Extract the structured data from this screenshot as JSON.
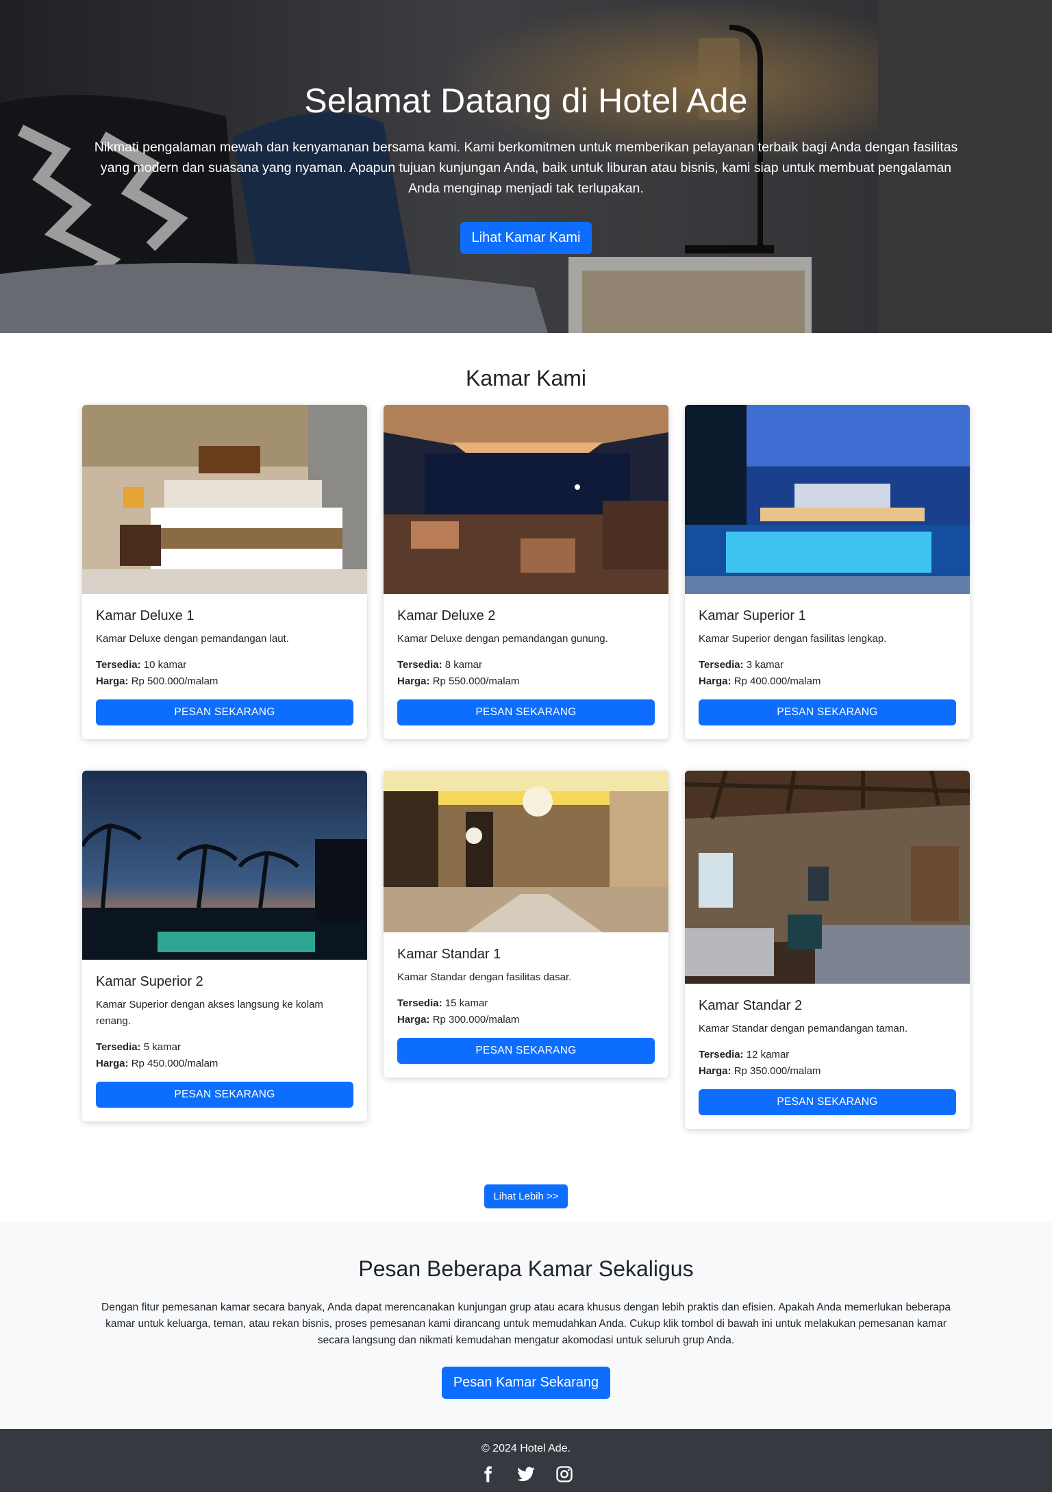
{
  "hero": {
    "title": "Selamat Datang di Hotel Ade",
    "text": "Nikmati pengalaman mewah dan kenyamanan bersama kami. Kami berkomitmen untuk memberikan pelayanan terbaik bagi Anda dengan fasilitas yang modern dan suasana yang nyaman. Apapun tujuan kunjungan Anda, baik untuk liburan atau bisnis, kami siap untuk membuat pengalaman Anda menginap menjadi tak terlupakan.",
    "button": "Lihat Kamar Kami"
  },
  "rooms": {
    "title": "Kamar Kami",
    "available_label": "Tersedia:",
    "price_label": "Harga:",
    "items": [
      {
        "name": "Kamar Deluxe 1",
        "desc": "Kamar Deluxe dengan pemandangan laut.",
        "available": "10 kamar",
        "price": "Rp 500.000/malam",
        "button": "Pesan Sekarang"
      },
      {
        "name": "Kamar Deluxe 2",
        "desc": "Kamar Deluxe dengan pemandangan gunung.",
        "available": "8 kamar",
        "price": "Rp 550.000/malam",
        "button": "Pesan Sekarang"
      },
      {
        "name": "Kamar Superior 1",
        "desc": "Kamar Superior dengan fasilitas lengkap.",
        "available": "3 kamar",
        "price": "Rp 400.000/malam",
        "button": "Pesan Sekarang"
      },
      {
        "name": "Kamar Superior 2",
        "desc": "Kamar Superior dengan akses langsung ke kolam renang.",
        "available": "5 kamar",
        "price": "Rp 450.000/malam",
        "button": "Pesan Sekarang"
      },
      {
        "name": "Kamar Standar 1",
        "desc": "Kamar Standar dengan fasilitas dasar.",
        "available": "15 kamar",
        "price": "Rp 300.000/malam",
        "button": "Pesan Sekarang"
      },
      {
        "name": "Kamar Standar 2",
        "desc": "Kamar Standar dengan pemandangan taman.",
        "available": "12 kamar",
        "price": "Rp 350.000/malam",
        "button": "Pesan Sekarang"
      }
    ],
    "more_button": "Lihat Lebih >>"
  },
  "bulk": {
    "title": "Pesan Beberapa Kamar Sekaligus",
    "text": "Dengan fitur pemesanan kamar secara banyak, Anda dapat merencanakan kunjungan grup atau acara khusus dengan lebih praktis dan efisien. Apakah Anda memerlukan beberapa kamar untuk keluarga, teman, atau rekan bisnis, proses pemesanan kami dirancang untuk memudahkan Anda. Cukup klik tombol di bawah ini untuk melakukan pemesanan kamar secara langsung dan nikmati kemudahan mengatur akomodasi untuk seluruh grup Anda.",
    "button": "Pesan Kamar Sekarang"
  },
  "footer": {
    "copyright": "© 2024 Hotel Ade.",
    "social": [
      "facebook-icon",
      "twitter-icon",
      "instagram-icon"
    ]
  },
  "colors": {
    "primary": "#0d6efd",
    "footer_bg": "#343a40",
    "section_bg": "#f8f9fa"
  }
}
